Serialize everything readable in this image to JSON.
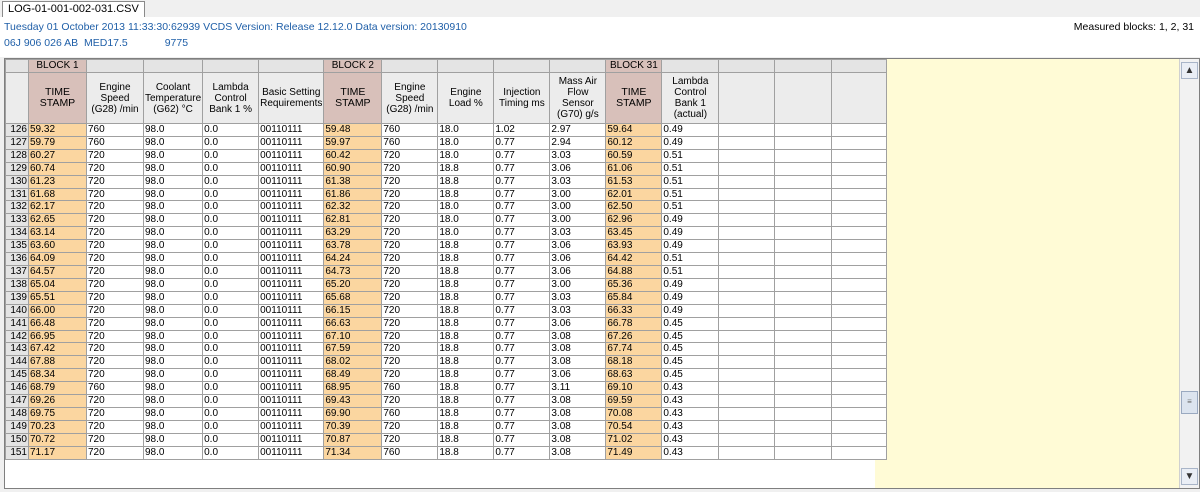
{
  "tab": {
    "label": "LOG-01-001-002-031.CSV"
  },
  "info": {
    "line1": "Tuesday 01 October 2013 11:33:30:62939 VCDS Version: Release 12.12.0 Data version: 20130910",
    "part_no": "06J 906 026 AB",
    "ecu": "MED17.5",
    "code": "9775",
    "measured": "Measured blocks: 1, 2, 31"
  },
  "blocks": {
    "b1": "BLOCK 1",
    "b2": "BLOCK 2",
    "b31": "BLOCK 31"
  },
  "headers": [
    "TIME STAMP",
    "Engine Speed (G28) /min",
    "Coolant Temperature (G62) °C",
    "Lambda Control Bank 1 %",
    "Basic Setting Requirements",
    "TIME STAMP",
    "Engine Speed (G28) /min",
    "Engine Load %",
    "Injection Timing ms",
    "Mass Air Flow Sensor (G70) g/s",
    "TIME STAMP",
    "Lambda Control Bank 1 (actual)"
  ],
  "rows": [
    [
      "126",
      "59.32",
      "760",
      "98.0",
      "0.0",
      "00110111",
      "59.48",
      "760",
      "18.0",
      "1.02",
      "2.97",
      "59.64",
      "0.49"
    ],
    [
      "127",
      "59.79",
      "760",
      "98.0",
      "0.0",
      "00110111",
      "59.97",
      "760",
      "18.0",
      "0.77",
      "2.94",
      "60.12",
      "0.49"
    ],
    [
      "128",
      "60.27",
      "720",
      "98.0",
      "0.0",
      "00110111",
      "60.42",
      "720",
      "18.0",
      "0.77",
      "3.03",
      "60.59",
      "0.51"
    ],
    [
      "129",
      "60.74",
      "720",
      "98.0",
      "0.0",
      "00110111",
      "60.90",
      "720",
      "18.8",
      "0.77",
      "3.06",
      "61.06",
      "0.51"
    ],
    [
      "130",
      "61.23",
      "720",
      "98.0",
      "0.0",
      "00110111",
      "61.38",
      "720",
      "18.8",
      "0.77",
      "3.03",
      "61.53",
      "0.51"
    ],
    [
      "131",
      "61.68",
      "720",
      "98.0",
      "0.0",
      "00110111",
      "61.86",
      "720",
      "18.8",
      "0.77",
      "3.00",
      "62.01",
      "0.51"
    ],
    [
      "132",
      "62.17",
      "720",
      "98.0",
      "0.0",
      "00110111",
      "62.32",
      "720",
      "18.0",
      "0.77",
      "3.00",
      "62.50",
      "0.51"
    ],
    [
      "133",
      "62.65",
      "720",
      "98.0",
      "0.0",
      "00110111",
      "62.81",
      "720",
      "18.0",
      "0.77",
      "3.00",
      "62.96",
      "0.49"
    ],
    [
      "134",
      "63.14",
      "720",
      "98.0",
      "0.0",
      "00110111",
      "63.29",
      "720",
      "18.0",
      "0.77",
      "3.03",
      "63.45",
      "0.49"
    ],
    [
      "135",
      "63.60",
      "720",
      "98.0",
      "0.0",
      "00110111",
      "63.78",
      "720",
      "18.8",
      "0.77",
      "3.06",
      "63.93",
      "0.49"
    ],
    [
      "136",
      "64.09",
      "720",
      "98.0",
      "0.0",
      "00110111",
      "64.24",
      "720",
      "18.8",
      "0.77",
      "3.06",
      "64.42",
      "0.51"
    ],
    [
      "137",
      "64.57",
      "720",
      "98.0",
      "0.0",
      "00110111",
      "64.73",
      "720",
      "18.8",
      "0.77",
      "3.06",
      "64.88",
      "0.51"
    ],
    [
      "138",
      "65.04",
      "720",
      "98.0",
      "0.0",
      "00110111",
      "65.20",
      "720",
      "18.8",
      "0.77",
      "3.00",
      "65.36",
      "0.49"
    ],
    [
      "139",
      "65.51",
      "720",
      "98.0",
      "0.0",
      "00110111",
      "65.68",
      "720",
      "18.8",
      "0.77",
      "3.03",
      "65.84",
      "0.49"
    ],
    [
      "140",
      "66.00",
      "720",
      "98.0",
      "0.0",
      "00110111",
      "66.15",
      "720",
      "18.8",
      "0.77",
      "3.03",
      "66.33",
      "0.49"
    ],
    [
      "141",
      "66.48",
      "720",
      "98.0",
      "0.0",
      "00110111",
      "66.63",
      "720",
      "18.8",
      "0.77",
      "3.06",
      "66.78",
      "0.45"
    ],
    [
      "142",
      "66.95",
      "720",
      "98.0",
      "0.0",
      "00110111",
      "67.10",
      "720",
      "18.8",
      "0.77",
      "3.08",
      "67.26",
      "0.45"
    ],
    [
      "143",
      "67.42",
      "720",
      "98.0",
      "0.0",
      "00110111",
      "67.59",
      "720",
      "18.8",
      "0.77",
      "3.08",
      "67.74",
      "0.45"
    ],
    [
      "144",
      "67.88",
      "720",
      "98.0",
      "0.0",
      "00110111",
      "68.02",
      "720",
      "18.8",
      "0.77",
      "3.08",
      "68.18",
      "0.45"
    ],
    [
      "145",
      "68.34",
      "720",
      "98.0",
      "0.0",
      "00110111",
      "68.49",
      "720",
      "18.8",
      "0.77",
      "3.06",
      "68.63",
      "0.45"
    ],
    [
      "146",
      "68.79",
      "760",
      "98.0",
      "0.0",
      "00110111",
      "68.95",
      "760",
      "18.8",
      "0.77",
      "3.11",
      "69.10",
      "0.43"
    ],
    [
      "147",
      "69.26",
      "720",
      "98.0",
      "0.0",
      "00110111",
      "69.43",
      "720",
      "18.8",
      "0.77",
      "3.08",
      "69.59",
      "0.43"
    ],
    [
      "148",
      "69.75",
      "720",
      "98.0",
      "0.0",
      "00110111",
      "69.90",
      "760",
      "18.8",
      "0.77",
      "3.08",
      "70.08",
      "0.43"
    ],
    [
      "149",
      "70.23",
      "720",
      "98.0",
      "0.0",
      "00110111",
      "70.39",
      "720",
      "18.8",
      "0.77",
      "3.08",
      "70.54",
      "0.43"
    ],
    [
      "150",
      "70.72",
      "720",
      "98.0",
      "0.0",
      "00110111",
      "70.87",
      "720",
      "18.8",
      "0.77",
      "3.08",
      "71.02",
      "0.43"
    ],
    [
      "151",
      "71.17",
      "720",
      "98.0",
      "0.0",
      "00110111",
      "71.34",
      "760",
      "18.8",
      "0.77",
      "3.08",
      "71.49",
      "0.43"
    ]
  ],
  "scrollbar": {
    "up": "▲",
    "down": "▼",
    "thumb": "≡"
  }
}
